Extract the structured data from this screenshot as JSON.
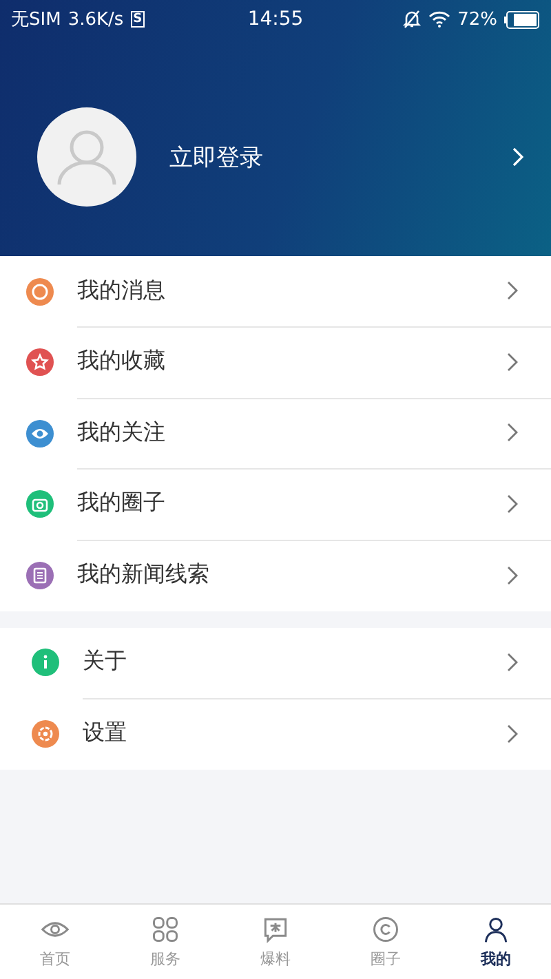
{
  "status_bar": {
    "carrier": "无SIM",
    "speed": "3.6K/s",
    "badge": "S",
    "time": "14:55",
    "battery": "72%"
  },
  "profile": {
    "login": "立即登录"
  },
  "menu_groups": [
    {
      "items": [
        {
          "label": "我的消息",
          "color": "#ee8a4f"
        },
        {
          "label": "我的收藏",
          "color": "#e05252"
        },
        {
          "label": "我的关注",
          "color": "#3d8fd1"
        },
        {
          "label": "我的圈子",
          "color": "#1fbf7a"
        },
        {
          "label": "我的新闻线索",
          "color": "#9b6fb5"
        }
      ]
    },
    {
      "items": [
        {
          "label": "关于",
          "color": "#1fbf7a"
        },
        {
          "label": "设置",
          "color": "#ee8a4f"
        }
      ]
    }
  ],
  "tabs": [
    {
      "label": "首页",
      "selected": false
    },
    {
      "label": "服务",
      "selected": false
    },
    {
      "label": "爆料",
      "selected": false
    },
    {
      "label": "圈子",
      "selected": false
    },
    {
      "label": "我的",
      "selected": true
    }
  ]
}
